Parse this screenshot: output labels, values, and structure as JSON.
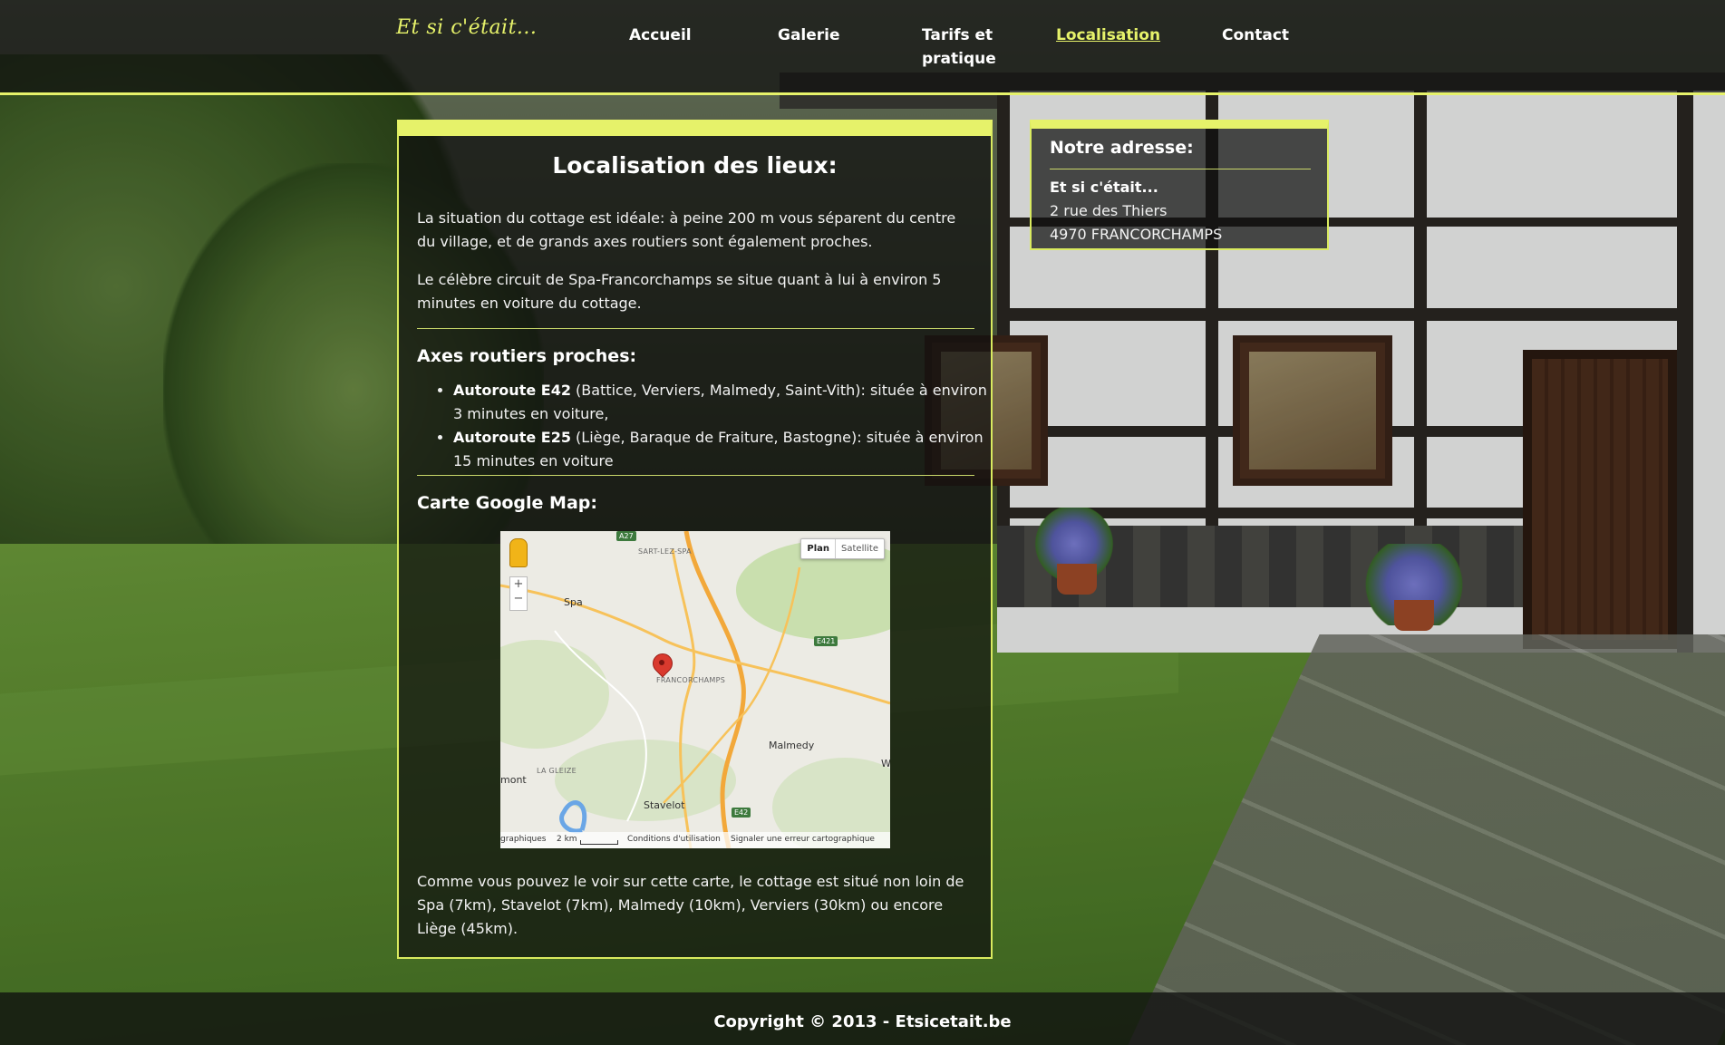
{
  "site": {
    "logo": "Et si c'était..."
  },
  "nav": {
    "items": [
      {
        "label": "Accueil",
        "active": false
      },
      {
        "label": "Galerie",
        "active": false
      },
      {
        "label": "Tarifs et pratique",
        "label_line1": "Tarifs et",
        "label_line2": "pratique",
        "active": false
      },
      {
        "label": "Localisation",
        "active": true
      },
      {
        "label": "Contact",
        "active": false
      }
    ],
    "accent_color": "#e6f26a"
  },
  "main": {
    "title": "Localisation des lieux:",
    "intro1": "La situation du cottage est idéale: à peine 200 m vous séparent du centre du village, et de grands axes routiers sont également proches.",
    "intro2": "Le célèbre circuit de Spa-Francorchamps se situe quant à lui à environ 5 minutes en voiture du cottage.",
    "roads_title": "Axes routiers proches:",
    "roads": [
      {
        "name": "Autoroute E42",
        "detail": " (Battice, Verviers, Malmedy, Saint-Vith): située à environ 3 minutes en voiture,"
      },
      {
        "name": "Autoroute E25",
        "detail": " (Liège, Baraque de Fraiture, Bastogne): située à environ 15 minutes en voiture"
      }
    ],
    "map_title": "Carte Google Map:",
    "outro": "Comme vous pouvez le voir sur cette carte, le cottage est situé non loin de Spa (7km), Stavelot (7km), Malmedy (10km), Verviers (30km) ou encore Liège (45km)."
  },
  "map": {
    "buttons": {
      "plan": "Plan",
      "satellite": "Satellite"
    },
    "zoom_in": "+",
    "zoom_out": "−",
    "labels": {
      "sart": "SART-LEZ-SPA",
      "spa": "Spa",
      "francorchamps": "FRANCORCHAMPS",
      "malmedy": "Malmedy",
      "lagleize": "LA GLEIZE",
      "stavelot": "Stavelot",
      "mont": "mont",
      "w": "W"
    },
    "shields": {
      "a27": "A27",
      "e421": "E421",
      "e42": "E42"
    },
    "footer": {
      "data": "graphiques",
      "scale": "2 km",
      "terms": "Conditions d'utilisation",
      "report": "Signaler une erreur cartographique"
    }
  },
  "address": {
    "title": "Notre adresse:",
    "name": "Et si c'était...",
    "street": "2 rue des Thiers",
    "city": "4970 FRANCORCHAMPS"
  },
  "footer": {
    "copyright": "Copyright © 2013 - Etsicetait.be"
  }
}
